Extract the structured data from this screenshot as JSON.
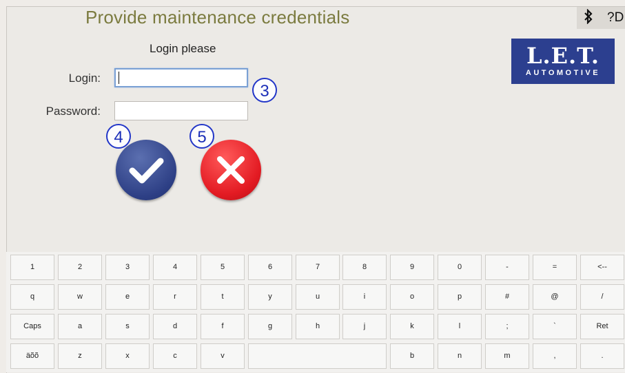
{
  "header": {
    "title": "Provide maintenance credentials",
    "status_icons": [
      "bluetooth-icon",
      "help-icon"
    ],
    "help_text": "?D"
  },
  "form": {
    "subtitle": "Login please",
    "login_label": "Login:",
    "login_value": "",
    "password_label": "Password:",
    "password_value": ""
  },
  "annotations": {
    "login": "3",
    "ok": "4",
    "cancel": "5"
  },
  "buttons": {
    "ok": "confirm-checkmark",
    "cancel": "cancel-x"
  },
  "logo": {
    "main": "L.E.T.",
    "sub": "AUTOMOTIVE"
  },
  "colors": {
    "title": "#7b7b3f",
    "ok": "#34478f",
    "cancel": "#e31b23",
    "logo_bg": "#2c3f8f",
    "badge": "#2236c8"
  },
  "keyboard": {
    "rows": [
      [
        "1",
        "2",
        "3",
        "4",
        "5",
        "6",
        "7",
        "8",
        "9",
        "0",
        "-",
        "=",
        "<--"
      ],
      [
        "q",
        "w",
        "e",
        "r",
        "t",
        "y",
        "u",
        "i",
        "o",
        "p",
        "#",
        "@",
        "/"
      ],
      [
        "Caps",
        "a",
        "s",
        "d",
        "f",
        "g",
        "h",
        "j",
        "k",
        "l",
        ";",
        "`",
        "Ret"
      ],
      [
        "äõõ",
        "z",
        "x",
        "c",
        "v",
        "",
        "b",
        "n",
        "m",
        ",",
        "."
      ]
    ]
  }
}
